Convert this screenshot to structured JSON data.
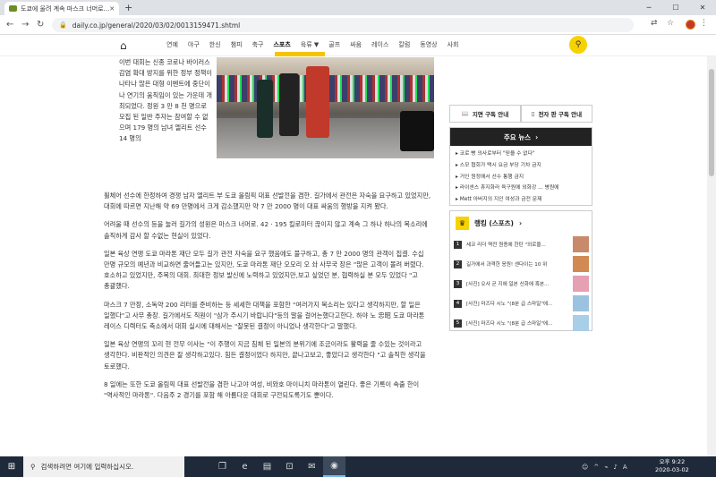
{
  "browser": {
    "tab_title": "도쿄에 울려 계속 마스크 너머로...",
    "url": "daily.co.jp/general/2020/03/02/0013159471.shtml"
  },
  "site_nav": {
    "items": [
      "연예",
      "야구",
      "한신",
      "챔피",
      "축구",
      "스포츠",
      "육류 ▼",
      "골프",
      "싸움",
      "레이스",
      "칼럼",
      "동영상",
      "사회"
    ],
    "active_index": 5
  },
  "article": {
    "lead": "이번 대회는 신종 코로나 바이러스 감염 확대 방지를 위한 정부 정책이 나타나 많은 대형 이벤트에 중단이나 연기의 움직임이 있는 가운데 개최되었다. 정원 3 만 8 천 명으로 모집 된 일반 주자는 참여할 수 없으며 179 명의 남녀 엘리트 선수 14 명의",
    "paragraphs": [
      "휠체어 선수에 한정하여 경쟁 남자 엘리트 부 도쿄 올림픽 대표 선발전을 겸한. 길가에서 관전은 자숙을 요구하고 있었지만, 대회에 따르면 지난해 약 69 만명에서 크게 감소했지만 약 7 만 2000 명이 대표 싸움의 행방을 지켜 봤다.",
      "어려울 때 선수의 등을 눌러 길가의 성원은 마스크 너머로. 42 · 195 킬로미터 끊이지 않고 계속 그 하나 하나의 목소리에 솔직하게 감사 할 수없는 현실이 있었다.",
      "일본 육상 연맹 도쿄 마라톤 재단 모두 길가 관전 자숙을 요구 했음에도 불구하고, 총 7 만 2000 명의 관객이 집결. 수십 만명 규모의 예년과 비교하면 줄어들고는 있지만, 도쿄 마라톤 재단 오모리 오 솨 사무국 장은 \"많은 고객이 몰려 버렸다. 호소하고 있었지만, 주목의 대회. 최대한 정보 발신에 노력하고 있었지만,보고 싶었던 분, 협력하실 분 모두 있었다 \"고 총괄했다.",
      "마스크 7 만장, 소독약 200 리터를 준비하는 등 세세한 대책을 포함한 \"여러가지 목소리는 있다고 생각하지만, 할 일은 일했다\"고 사무 총장. 길가에서도 직원이 \"삼가 주시기 바랍니다\"등의 말을 걸어는했다고한다. 하야 노 忠昭 도쿄 마라톤 레이스 디렉터도 축소에서 대회 실시에 대해서는 \"잘못된 결정이 아니었나 생각한다\"고 말했다.",
      "일본 육상 연맹의 꼬리 현 전무 이사는 \"이 주행이 지금 침체 된 일본의 분위기에 조금이라도 활력을 줄 수있는 것이라고 생각한다. 비판적인 의견은 잘 생각하고있다. 힘든 결정이었다 하지만, 끝나고보고, 좋았다고 생각한다 \"고 솔직한 생각을 토로했다.",
      "8 일에는 또한 도쿄 올림픽 대표 선발전을 겸한 나고야 여성, 비와호 마이니치 마라톤이 열린다. 좋은 기록이 속출 한이 \"역사적인 마라톤\". 다음주 2 경기를 포함 해 아름다운 대회로 구전되도록기도 뿐이다."
    ]
  },
  "sidebar": {
    "sub_buttons": [
      "지면 구독 안내",
      "전자 판 구독 안내"
    ],
    "news_title": "주요 뉴스",
    "news_items": [
      "코로 빵 의사로부터 \"믿을 수 없다\"",
      "스모 협회가 택시 요금 부당 기차 금지",
      "거인 원정에서 선수 통행 금지",
      "라이센스 휴지화라 육구원에 외화강 ... 병원에",
      "Mett 아버지의 지인 여성과 금전 문제"
    ],
    "ranking_title": "랭킹 (스포츠)",
    "ranking": [
      {
        "num": "1",
        "text": "세코 리더 역전 원종에 한탄 \"외로울..."
      },
      {
        "num": "2",
        "text": "길가에서 과격한 응원! 센다이는 10 위"
      },
      {
        "num": "3",
        "text": "[사진] 오사 균 지에 일본 신화에 혹본..."
      },
      {
        "num": "4",
        "text": "[사진] 마즈다 시노 \"(8분 급 스마일\"에..."
      },
      {
        "num": "5",
        "text": "[사진] 마즈다 시노 \"(8분 급 스마일\"에..."
      }
    ]
  },
  "taskbar": {
    "search_placeholder": "검색하려면 여기에 입력하십시오.",
    "time": "오후 9:22",
    "date": "2020-03-02"
  }
}
